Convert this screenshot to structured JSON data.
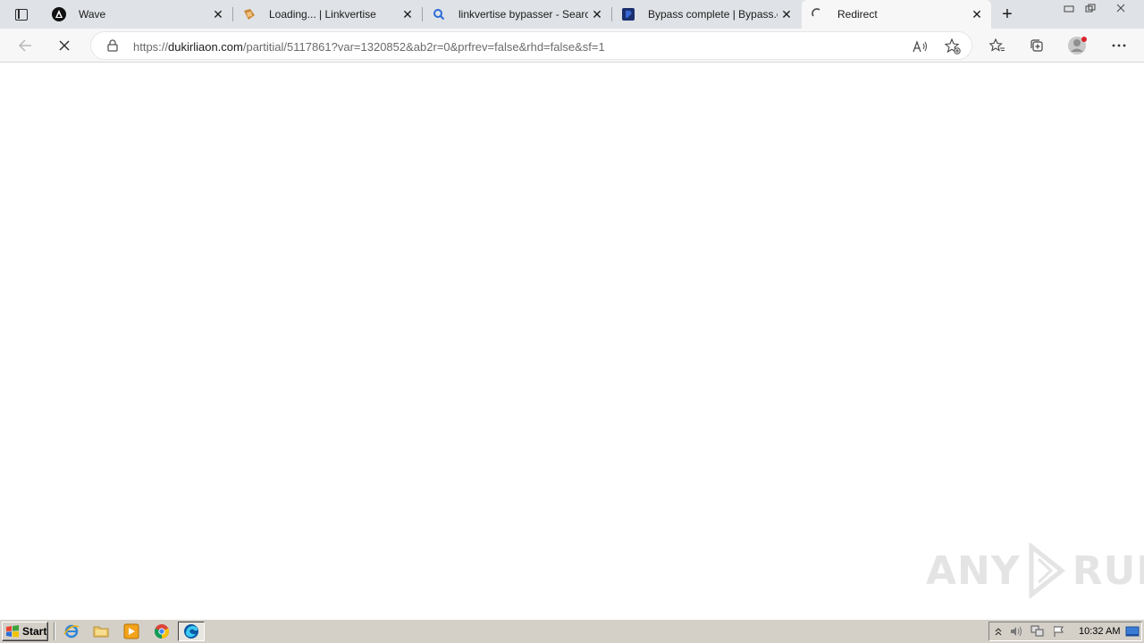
{
  "browser": {
    "tabs": [
      {
        "title": "Wave",
        "favicon": "wave-logo-icon"
      },
      {
        "title": "Loading... | Linkvertise",
        "favicon": "linkvertise-icon"
      },
      {
        "title": "linkvertise bypasser - Search",
        "favicon": "search-icon"
      },
      {
        "title": "Bypass complete | Bypass.ci",
        "favicon": "bypass-ci-icon"
      },
      {
        "title": "Redirect",
        "favicon": "loading-spinner-icon",
        "active": true
      }
    ],
    "address": {
      "scheme": "https://",
      "host": "dukirliaon.com",
      "path": "/partitial/5117861?var=1320852&ab2r=0&prfrev=false&rhd=false&sf=1"
    }
  },
  "watermark": {
    "left": "ANY",
    "right": "RUN"
  },
  "taskbar": {
    "start_label": "Start",
    "clock": "10:32 AM"
  }
}
